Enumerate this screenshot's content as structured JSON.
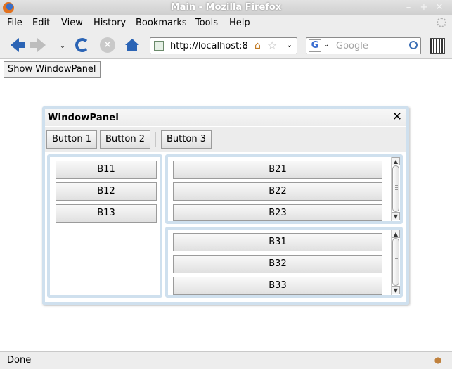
{
  "window": {
    "title": "Main - Mozilla Firefox"
  },
  "menu": {
    "items": [
      "File",
      "Edit",
      "View",
      "History",
      "Bookmarks",
      "Tools",
      "Help"
    ]
  },
  "nav": {
    "url": "http://localhost:8",
    "search_placeholder": "Google",
    "search_engine_letter": "G"
  },
  "page": {
    "show_button": "Show WindowPanel"
  },
  "panel": {
    "title": "WindowPanel",
    "close_glyph": "✕",
    "toolbar": [
      "Button 1",
      "Button 2",
      "Button 3"
    ],
    "left_buttons": [
      "B11",
      "B12",
      "B13"
    ],
    "top_right_buttons": [
      "B21",
      "B22",
      "B23"
    ],
    "bottom_right_buttons": [
      "B31",
      "B32",
      "B33"
    ]
  },
  "status": {
    "text": "Done"
  }
}
